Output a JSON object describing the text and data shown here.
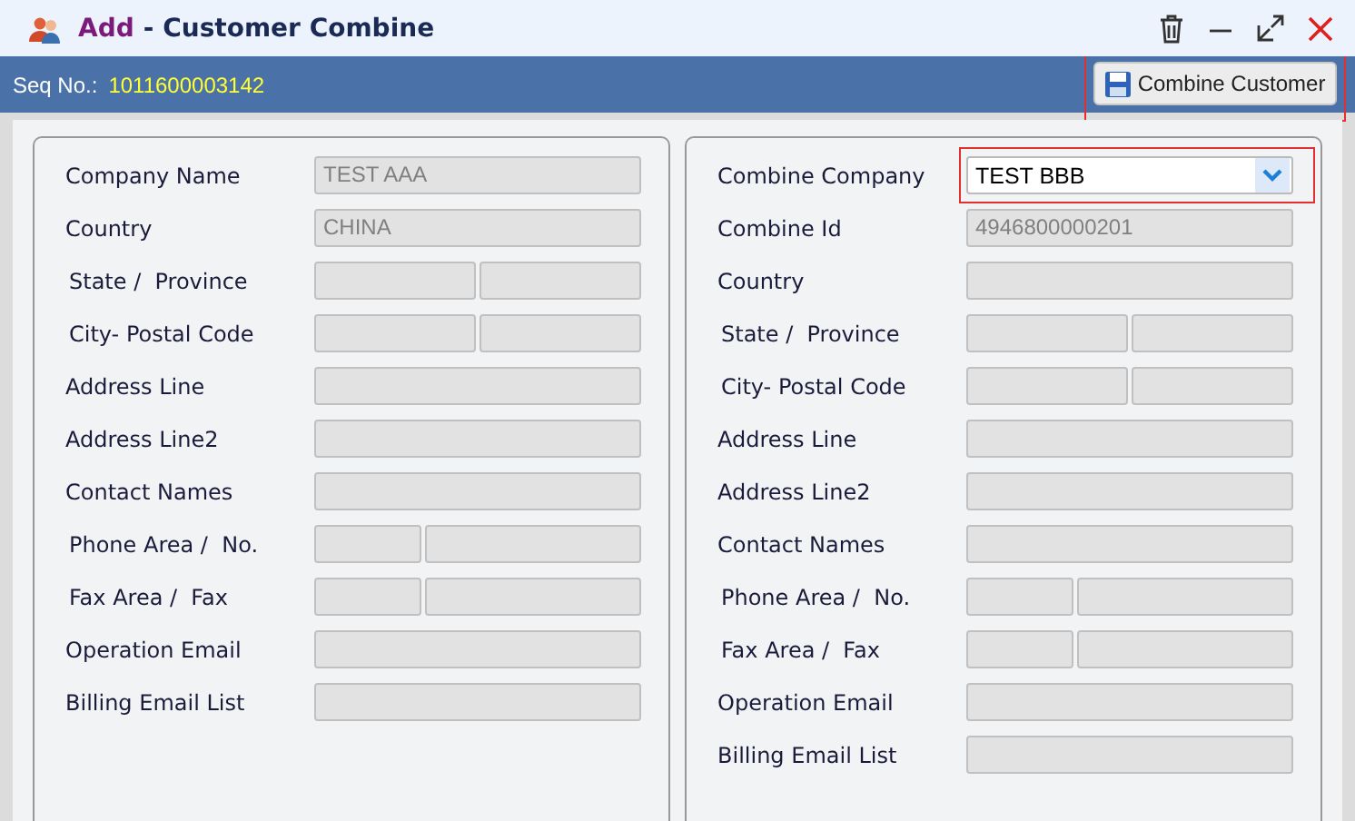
{
  "window": {
    "title_action": "Add",
    "title": "- Customer Combine"
  },
  "header": {
    "seq_label": "Seq No.:",
    "seq_value": "1011600003142",
    "button": "Combine Customer"
  },
  "left_panel": {
    "rows": [
      {
        "label": "Company Name",
        "kind": "single",
        "value": "TEST AAA",
        "disabled": true
      },
      {
        "label": "Country",
        "kind": "single",
        "value": "CHINA",
        "disabled": true
      },
      {
        "label": "State /  Province",
        "kind": "split",
        "disabled": true
      },
      {
        "label": "City- Postal Code",
        "kind": "split",
        "disabled": true
      },
      {
        "label": "Address Line",
        "kind": "single",
        "disabled": true
      },
      {
        "label": "Address Line2",
        "kind": "single",
        "disabled": true
      },
      {
        "label": "Contact Names",
        "kind": "single",
        "disabled": true
      },
      {
        "label": "Phone Area /  No.",
        "kind": "phone",
        "disabled": true
      },
      {
        "label": "Fax Area /  Fax",
        "kind": "phone",
        "disabled": true
      },
      {
        "label": "Operation Email",
        "kind": "single",
        "disabled": true
      },
      {
        "label": "Billing Email List",
        "kind": "single",
        "disabled": true
      }
    ]
  },
  "right_panel": {
    "rows": [
      {
        "label": "Combine Company",
        "kind": "select",
        "value": "TEST BBB",
        "disabled": false
      },
      {
        "label": "Combine Id",
        "kind": "single",
        "value": "4946800000201",
        "disabled": true
      },
      {
        "label": "Country",
        "kind": "single",
        "disabled": true
      },
      {
        "label": "State /  Province",
        "kind": "split",
        "disabled": true
      },
      {
        "label": "City- Postal Code",
        "kind": "split",
        "disabled": true
      },
      {
        "label": "Address Line",
        "kind": "single",
        "disabled": true
      },
      {
        "label": "Address Line2",
        "kind": "single",
        "disabled": true
      },
      {
        "label": "Contact Names",
        "kind": "single",
        "disabled": true
      },
      {
        "label": "Phone Area /  No.",
        "kind": "phone",
        "disabled": true
      },
      {
        "label": "Fax Area /  Fax",
        "kind": "phone",
        "disabled": true
      },
      {
        "label": "Operation Email",
        "kind": "single",
        "disabled": true
      },
      {
        "label": "Billing Email List",
        "kind": "single",
        "disabled": true
      }
    ]
  }
}
